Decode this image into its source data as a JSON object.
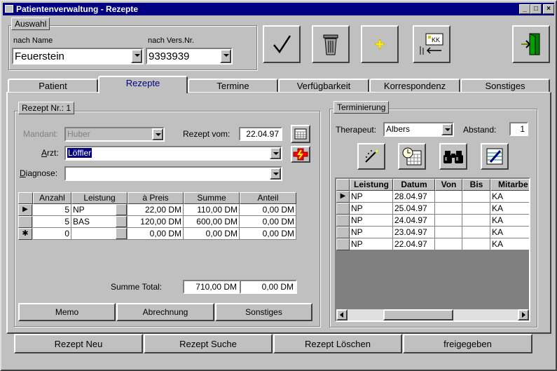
{
  "window": {
    "title": "Patientenverwaltung - Rezepte",
    "min": "_",
    "max": "□",
    "close": "×"
  },
  "auswahl": {
    "group_label": "Auswahl",
    "name_label": "nach Name",
    "name_value": "Feuerstein",
    "versnr_label": "nach Vers.Nr.",
    "versnr_value": "9393939"
  },
  "toolbar": {
    "icons": [
      "checkmark-icon",
      "trash-icon",
      "new-star-icon",
      "card-import-icon",
      "exit-door-icon"
    ]
  },
  "tabs": [
    "Patient",
    "Rezepte",
    "Termine",
    "Verfügbarkeit",
    "Korrespondenz",
    "Sonstiges"
  ],
  "rezept": {
    "group_label": "Rezept Nr.: 1",
    "mandant_label": "Mandant:",
    "mandant_value": "Huber",
    "rezept_vom_label": "Rezept vom:",
    "rezept_vom_value": "22.04.97",
    "arzt_label": "Arzt:",
    "arzt_value": "Löffler",
    "diagnose_label": "Diagnose:",
    "diagnose_value": "",
    "columns": [
      "Anzahl",
      "Leistung",
      "à Preis",
      "Summe",
      "Anteil"
    ],
    "rows": [
      {
        "anzahl": "5",
        "leistung": "NP",
        "preis": "22,00 DM",
        "summe": "110,00 DM",
        "anteil": "0,00 DM",
        "marker": "▶"
      },
      {
        "anzahl": "5",
        "leistung": "BAS",
        "preis": "120,00 DM",
        "summe": "600,00 DM",
        "anteil": "0,00 DM",
        "marker": ""
      },
      {
        "anzahl": "0",
        "leistung": "",
        "preis": "0,00 DM",
        "summe": "0,00 DM",
        "anteil": "0,00 DM",
        "marker": "✱"
      }
    ],
    "summe_total_label": "Summe Total:",
    "summe_total_value": "710,00 DM",
    "anteil_total_value": "0,00 DM",
    "buttons": {
      "memo": "Memo",
      "abrechnung": "Abrechnung",
      "sonstiges": "Sonstiges"
    }
  },
  "terminierung": {
    "group_label": "Terminierung",
    "therapeut_label": "Therapeut:",
    "therapeut_value": "Albers",
    "abstand_label": "Abstand:",
    "abstand_value": "1",
    "columns": [
      "Leistung",
      "Datum",
      "Von",
      "Bis",
      "Mitarbe"
    ],
    "rows": [
      {
        "leistung": "NP",
        "datum": "28.04.97",
        "von": "",
        "bis": "",
        "mitarb": "KA"
      },
      {
        "leistung": "NP",
        "datum": "25.04.97",
        "von": "",
        "bis": "",
        "mitarb": "KA"
      },
      {
        "leistung": "NP",
        "datum": "24.04.97",
        "von": "",
        "bis": "",
        "mitarb": "KA"
      },
      {
        "leistung": "NP",
        "datum": "23.04.97",
        "von": "",
        "bis": "",
        "mitarb": "KA"
      },
      {
        "leistung": "NP",
        "datum": "22.04.97",
        "von": "",
        "bis": "",
        "mitarb": "KA"
      }
    ]
  },
  "bottom_buttons": {
    "neu": "Rezept Neu",
    "suche": "Rezept Suche",
    "loeschen": "Rezept Löschen",
    "freigegeben": "freigegeben"
  }
}
